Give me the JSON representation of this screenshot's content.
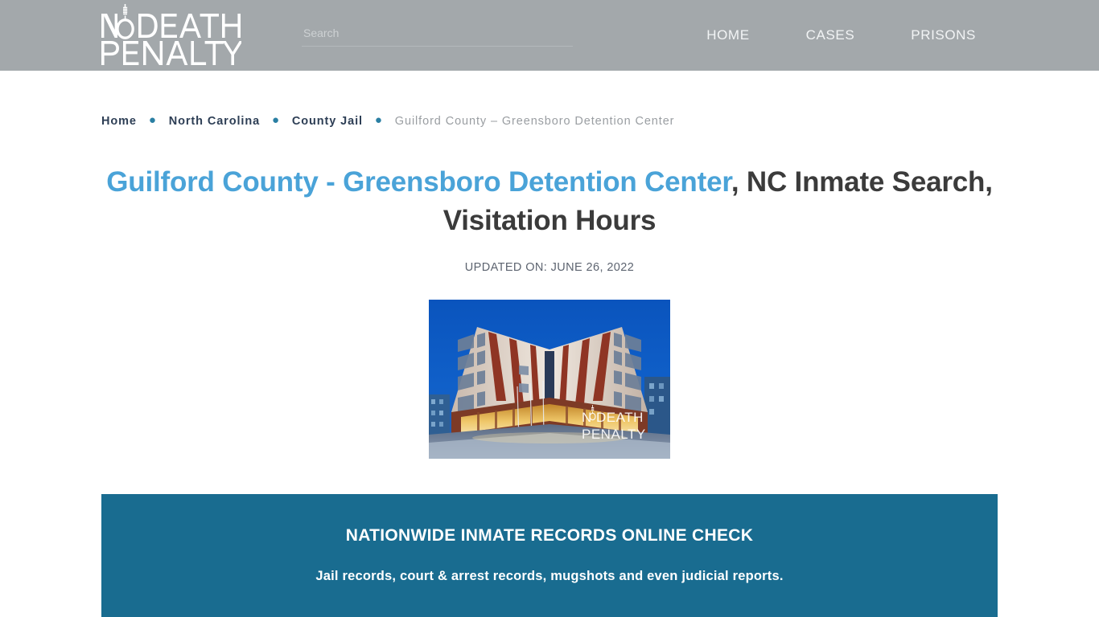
{
  "header": {
    "logo": {
      "line1": "NO DEATH",
      "line2": "PENALTY",
      "icon": "noose-icon",
      "alt": "No Death Penalty"
    },
    "search": {
      "placeholder": "Search",
      "value": ""
    },
    "nav": [
      {
        "label": "HOME",
        "name": "nav-link-home"
      },
      {
        "label": "CASES",
        "name": "nav-link-cases"
      },
      {
        "label": "PRISONS",
        "name": "nav-link-prisons"
      }
    ],
    "colors": {
      "background": "#a3a8ab",
      "link": "#f2f4f5"
    }
  },
  "breadcrumb": {
    "separator": "●",
    "items": [
      {
        "label": "Home",
        "current": false
      },
      {
        "label": "North Carolina",
        "current": false
      },
      {
        "label": "County Jail",
        "current": false
      },
      {
        "label": "Guilford County – Greensboro Detention Center",
        "current": true
      }
    ]
  },
  "main": {
    "title": {
      "accent_text": "Guilford County - Greensboro Detention Center",
      "rest_text": ", NC Inmate Search, Visitation Hours",
      "accent_color": "#4aa3d8",
      "text_color": "#3b3b3b"
    },
    "updated_on": "UPDATED ON: JUNE 26, 2022",
    "hero_image": {
      "alt": "Guilford County - Greensboro Detention Center building at dusk",
      "watermark_line1": "NO DEATH",
      "watermark_line2": "PENALTY",
      "width": "300",
      "height": "198"
    },
    "promo": {
      "title": "NATIONWIDE INMATE RECORDS ONLINE CHECK",
      "subtitle": "Jail records, court & arrest records, mugshots and even judicial reports.",
      "background_color": "#196c90",
      "text_color": "#ffffff"
    }
  }
}
